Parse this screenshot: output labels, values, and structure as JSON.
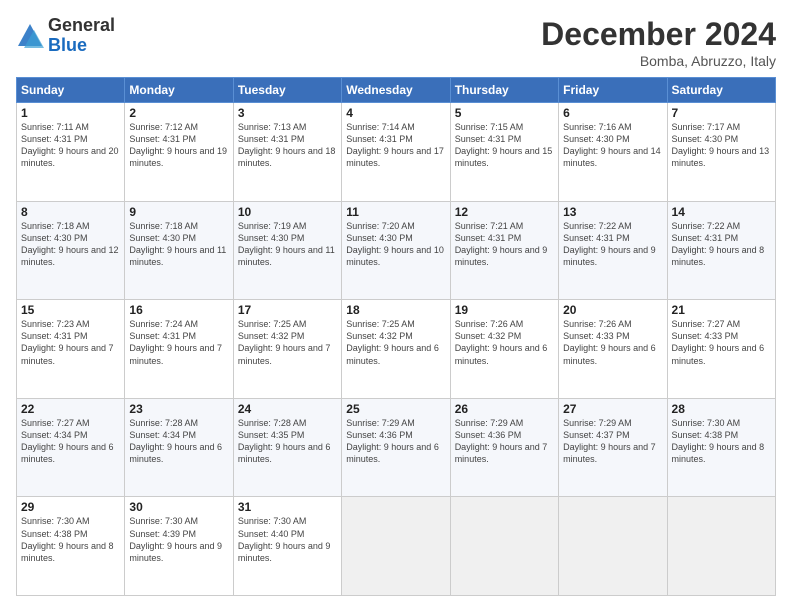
{
  "logo": {
    "general": "General",
    "blue": "Blue"
  },
  "header": {
    "month": "December 2024",
    "location": "Bomba, Abruzzo, Italy"
  },
  "days_of_week": [
    "Sunday",
    "Monday",
    "Tuesday",
    "Wednesday",
    "Thursday",
    "Friday",
    "Saturday"
  ],
  "weeks": [
    [
      {
        "day": "1",
        "sunrise": "7:11 AM",
        "sunset": "4:31 PM",
        "daylight": "9 hours and 20 minutes."
      },
      {
        "day": "2",
        "sunrise": "7:12 AM",
        "sunset": "4:31 PM",
        "daylight": "9 hours and 19 minutes."
      },
      {
        "day": "3",
        "sunrise": "7:13 AM",
        "sunset": "4:31 PM",
        "daylight": "9 hours and 18 minutes."
      },
      {
        "day": "4",
        "sunrise": "7:14 AM",
        "sunset": "4:31 PM",
        "daylight": "9 hours and 17 minutes."
      },
      {
        "day": "5",
        "sunrise": "7:15 AM",
        "sunset": "4:31 PM",
        "daylight": "9 hours and 15 minutes."
      },
      {
        "day": "6",
        "sunrise": "7:16 AM",
        "sunset": "4:30 PM",
        "daylight": "9 hours and 14 minutes."
      },
      {
        "day": "7",
        "sunrise": "7:17 AM",
        "sunset": "4:30 PM",
        "daylight": "9 hours and 13 minutes."
      }
    ],
    [
      {
        "day": "8",
        "sunrise": "7:18 AM",
        "sunset": "4:30 PM",
        "daylight": "9 hours and 12 minutes."
      },
      {
        "day": "9",
        "sunrise": "7:18 AM",
        "sunset": "4:30 PM",
        "daylight": "9 hours and 11 minutes."
      },
      {
        "day": "10",
        "sunrise": "7:19 AM",
        "sunset": "4:30 PM",
        "daylight": "9 hours and 11 minutes."
      },
      {
        "day": "11",
        "sunrise": "7:20 AM",
        "sunset": "4:30 PM",
        "daylight": "9 hours and 10 minutes."
      },
      {
        "day": "12",
        "sunrise": "7:21 AM",
        "sunset": "4:31 PM",
        "daylight": "9 hours and 9 minutes."
      },
      {
        "day": "13",
        "sunrise": "7:22 AM",
        "sunset": "4:31 PM",
        "daylight": "9 hours and 9 minutes."
      },
      {
        "day": "14",
        "sunrise": "7:22 AM",
        "sunset": "4:31 PM",
        "daylight": "9 hours and 8 minutes."
      }
    ],
    [
      {
        "day": "15",
        "sunrise": "7:23 AM",
        "sunset": "4:31 PM",
        "daylight": "9 hours and 7 minutes."
      },
      {
        "day": "16",
        "sunrise": "7:24 AM",
        "sunset": "4:31 PM",
        "daylight": "9 hours and 7 minutes."
      },
      {
        "day": "17",
        "sunrise": "7:25 AM",
        "sunset": "4:32 PM",
        "daylight": "9 hours and 7 minutes."
      },
      {
        "day": "18",
        "sunrise": "7:25 AM",
        "sunset": "4:32 PM",
        "daylight": "9 hours and 6 minutes."
      },
      {
        "day": "19",
        "sunrise": "7:26 AM",
        "sunset": "4:32 PM",
        "daylight": "9 hours and 6 minutes."
      },
      {
        "day": "20",
        "sunrise": "7:26 AM",
        "sunset": "4:33 PM",
        "daylight": "9 hours and 6 minutes."
      },
      {
        "day": "21",
        "sunrise": "7:27 AM",
        "sunset": "4:33 PM",
        "daylight": "9 hours and 6 minutes."
      }
    ],
    [
      {
        "day": "22",
        "sunrise": "7:27 AM",
        "sunset": "4:34 PM",
        "daylight": "9 hours and 6 minutes."
      },
      {
        "day": "23",
        "sunrise": "7:28 AM",
        "sunset": "4:34 PM",
        "daylight": "9 hours and 6 minutes."
      },
      {
        "day": "24",
        "sunrise": "7:28 AM",
        "sunset": "4:35 PM",
        "daylight": "9 hours and 6 minutes."
      },
      {
        "day": "25",
        "sunrise": "7:29 AM",
        "sunset": "4:36 PM",
        "daylight": "9 hours and 6 minutes."
      },
      {
        "day": "26",
        "sunrise": "7:29 AM",
        "sunset": "4:36 PM",
        "daylight": "9 hours and 7 minutes."
      },
      {
        "day": "27",
        "sunrise": "7:29 AM",
        "sunset": "4:37 PM",
        "daylight": "9 hours and 7 minutes."
      },
      {
        "day": "28",
        "sunrise": "7:30 AM",
        "sunset": "4:38 PM",
        "daylight": "9 hours and 8 minutes."
      }
    ],
    [
      {
        "day": "29",
        "sunrise": "7:30 AM",
        "sunset": "4:38 PM",
        "daylight": "9 hours and 8 minutes."
      },
      {
        "day": "30",
        "sunrise": "7:30 AM",
        "sunset": "4:39 PM",
        "daylight": "9 hours and 9 minutes."
      },
      {
        "day": "31",
        "sunrise": "7:30 AM",
        "sunset": "4:40 PM",
        "daylight": "9 hours and 9 minutes."
      },
      null,
      null,
      null,
      null
    ]
  ],
  "labels": {
    "sunrise": "Sunrise:",
    "sunset": "Sunset:",
    "daylight": "Daylight:"
  }
}
